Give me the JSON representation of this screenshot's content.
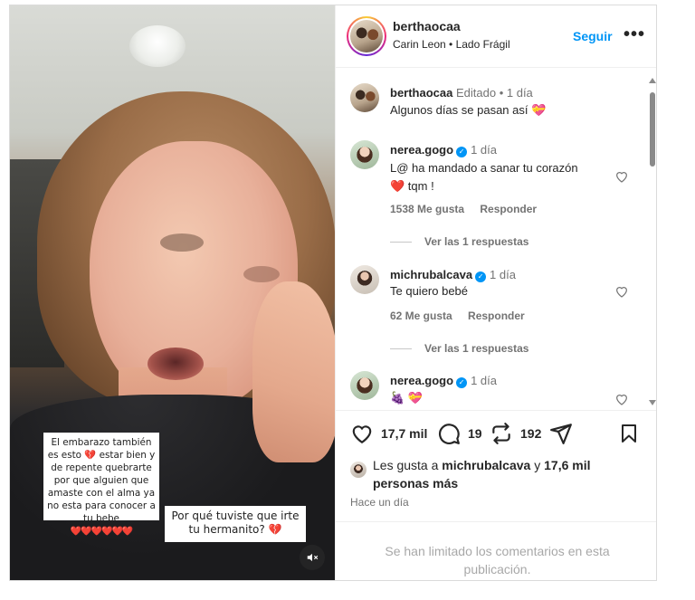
{
  "header": {
    "username": "berthaocaa",
    "audio": "Carin Leon • Lado Frágil",
    "follow_label": "Seguir",
    "more_label": "•••"
  },
  "media": {
    "caption_1_text": "El embarazo también es esto 💔 estar bien y de repente quebrarte por que alguien que amaste con el alma ya no esta para conocer a tu bebe",
    "caption_1_hearts": "❤️❤️❤️❤️❤️❤️",
    "caption_2_text": "Por qué tuviste que irte tu hermanito? 💔",
    "mute_icon": "speaker-muted-icon"
  },
  "caption_comment": {
    "username": "berthaocaa",
    "meta": "Editado  •  1 día",
    "text": "Algunos días se pasan así 💝"
  },
  "comments": [
    {
      "username": "nerea.gogo",
      "verified": true,
      "time": "1 día",
      "text_line1": "L@ ha mandado a sanar tu corazón",
      "text_line2_emoji": "❤️",
      "text_line2": " tqm !",
      "likes": "1538 Me gusta",
      "reply_label": "Responder",
      "replies_label": "Ver las 1 respuestas"
    },
    {
      "username": "michrubalcava",
      "verified": true,
      "time": "1 día",
      "text": "Te quiero bebé",
      "likes": "62 Me gusta",
      "reply_label": "Responder",
      "replies_label": "Ver las 1 respuestas"
    },
    {
      "username": "nerea.gogo",
      "verified": true,
      "time": "1 día",
      "text_emoji_1": "🍇",
      "text_emoji_2": "💝"
    }
  ],
  "actions": {
    "likes_count": "17,7 mil",
    "comments_count": "19",
    "reposts_count": "192"
  },
  "liked_by": {
    "prefix": "Les gusta a ",
    "user": "michrubalcava",
    "middle": " y ",
    "others": "17,6 mil personas más"
  },
  "posted": "Hace un día",
  "comments_limited": "Se han limitado los comentarios en esta publicación.",
  "colors": {
    "accent": "#0095f6",
    "text": "#262626",
    "secondary": "#737373"
  }
}
